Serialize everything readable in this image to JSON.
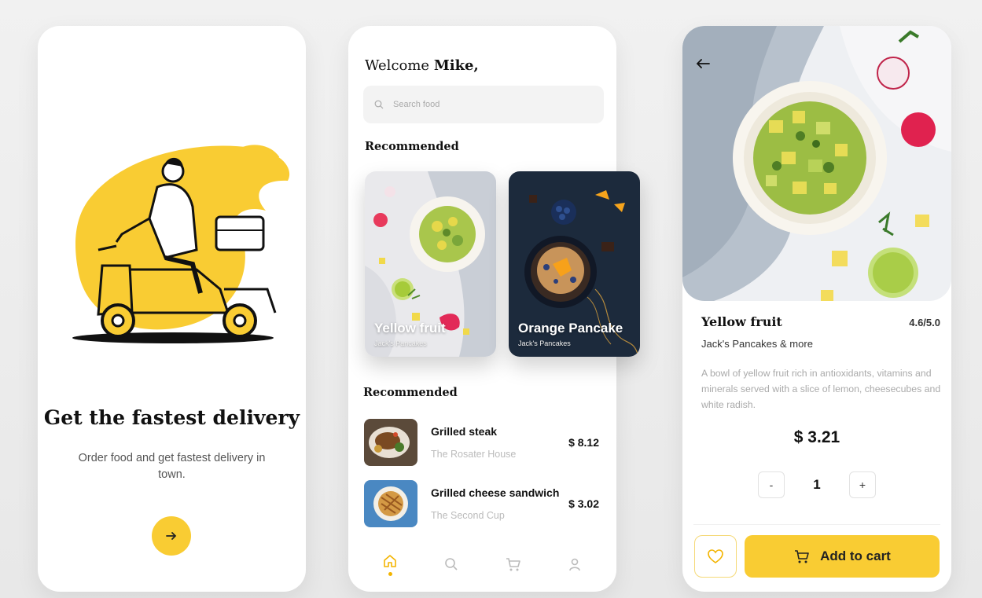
{
  "colors": {
    "accent": "#f9cc33",
    "background": "#eeeeee",
    "card": "#ffffff",
    "text": "#111111",
    "muted": "#aaaaaa"
  },
  "onboarding": {
    "title": "Get the fastest delivery",
    "subtitle": "Order food and get fastest  delivery in town.",
    "next_icon": "arrow-right-icon"
  },
  "home": {
    "greeting_prefix": "Welcome ",
    "user_name": "Mike,",
    "search": {
      "placeholder": "Search food",
      "icon": "search-icon"
    },
    "recommended_title": "Recommended",
    "featured": [
      {
        "name": "Yellow fruit",
        "place": "Jack's Pancakes"
      },
      {
        "name": "Orange Pancake",
        "place": "Jack's Pancakes"
      }
    ],
    "list_title": "Recommended",
    "items": [
      {
        "name": "Grilled steak",
        "place": "The Rosater House",
        "price": "$ 8.12"
      },
      {
        "name": "Grilled cheese sandwich",
        "place": "The Second Cup",
        "price": "$ 3.02"
      }
    ],
    "nav": [
      {
        "icon": "home-icon",
        "active": true
      },
      {
        "icon": "search-icon",
        "active": false
      },
      {
        "icon": "cart-icon",
        "active": false
      },
      {
        "icon": "profile-icon",
        "active": false
      }
    ]
  },
  "detail": {
    "back_icon": "arrow-left-icon",
    "title": "Yellow fruit",
    "rating": "4.6/5.0",
    "place": "Jack's Pancakes & more",
    "description": "A bowl of yellow fruit rich in antioxidants, vitamins and minerals served with a slice of lemon, cheesecubes and white radish.",
    "price": "$ 3.21",
    "qty_minus": "-",
    "quantity": "1",
    "qty_plus": "+",
    "favorite_icon": "heart-icon",
    "add_to_cart": "Add to cart",
    "cart_icon": "cart-icon"
  }
}
